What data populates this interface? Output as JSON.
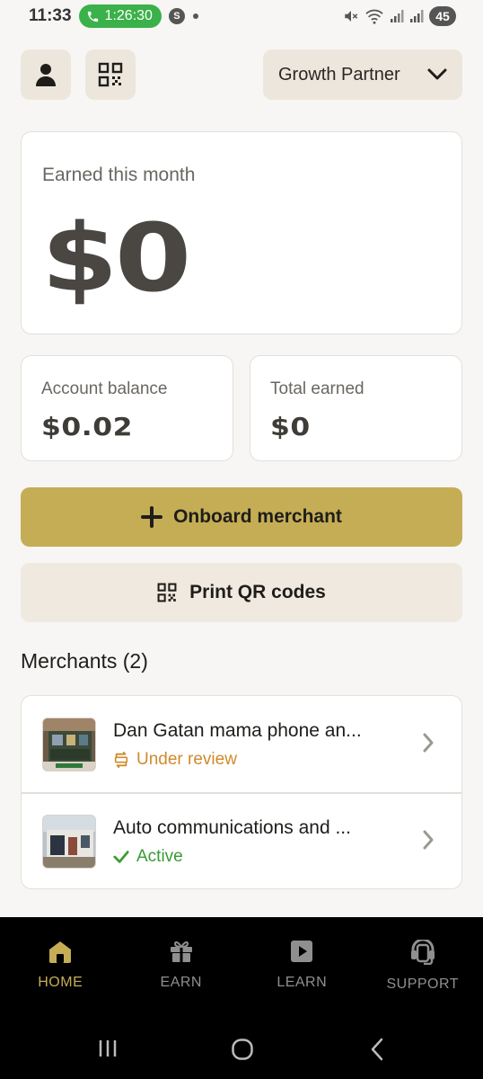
{
  "status_bar": {
    "time": "11:33",
    "call_duration": "1:26:30",
    "app_badge": "S",
    "battery": "45"
  },
  "header": {
    "role_label": "Growth Partner"
  },
  "earnings": {
    "month_label": "Earned this month",
    "month_value": "$0",
    "balance_label": "Account balance",
    "balance_value": "$0.02",
    "total_label": "Total earned",
    "total_value": "$0"
  },
  "actions": {
    "onboard_label": "Onboard merchant",
    "print_label": "Print QR codes"
  },
  "merchants": {
    "title": "Merchants (2)",
    "items": [
      {
        "name": "Dan Gatan mama phone an...",
        "status": "Under review",
        "status_color": "#d08a2d"
      },
      {
        "name": "Auto communications and ...",
        "status": "Active",
        "status_color": "#3a9a37"
      }
    ]
  },
  "nav": {
    "items": [
      {
        "label": "HOME",
        "icon": "home-icon",
        "active": true
      },
      {
        "label": "EARN",
        "icon": "gift-icon",
        "active": false
      },
      {
        "label": "LEARN",
        "icon": "play-icon",
        "active": false
      },
      {
        "label": "SUPPORT",
        "icon": "headset-icon",
        "active": false
      }
    ]
  },
  "colors": {
    "accent": "#c5ad55",
    "tile": "#ece6dc",
    "text": "#1f1d1a"
  }
}
